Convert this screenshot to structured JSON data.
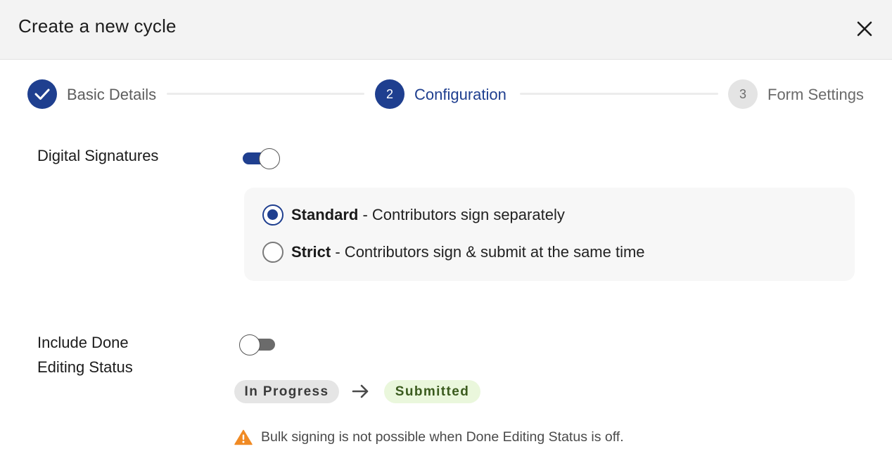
{
  "dialog": {
    "title": "Create a new cycle",
    "close_icon": "close-icon"
  },
  "stepper": {
    "steps": [
      {
        "number": "1",
        "label": "Basic Details",
        "state": "completed",
        "icon": "check-icon"
      },
      {
        "number": "2",
        "label": "Configuration",
        "state": "active"
      },
      {
        "number": "3",
        "label": "Form Settings",
        "state": "pending"
      }
    ]
  },
  "digital_signatures": {
    "label": "Digital Signatures",
    "enabled": true,
    "options": [
      {
        "name": "Standard",
        "description": " - Contributors sign separately",
        "selected": true
      },
      {
        "name": "Strict",
        "description": " - Contributors sign & submit at the same time",
        "selected": false
      }
    ]
  },
  "done_editing": {
    "label_line1": "Include Done",
    "label_line2": "Editing Status",
    "enabled": false,
    "status_from": "In Progress",
    "status_to": "Submitted",
    "arrow_icon": "arrow-right-icon",
    "warning_icon": "warning-icon",
    "warning_text": "Bulk signing is not possible when Done Editing Status is off."
  },
  "colors": {
    "primary": "#1f3f8f",
    "header_bg": "#f3f3f3",
    "warning": "#f08a24",
    "submitted_bg": "#eaf7dc",
    "submitted_text": "#3b5b1e"
  }
}
